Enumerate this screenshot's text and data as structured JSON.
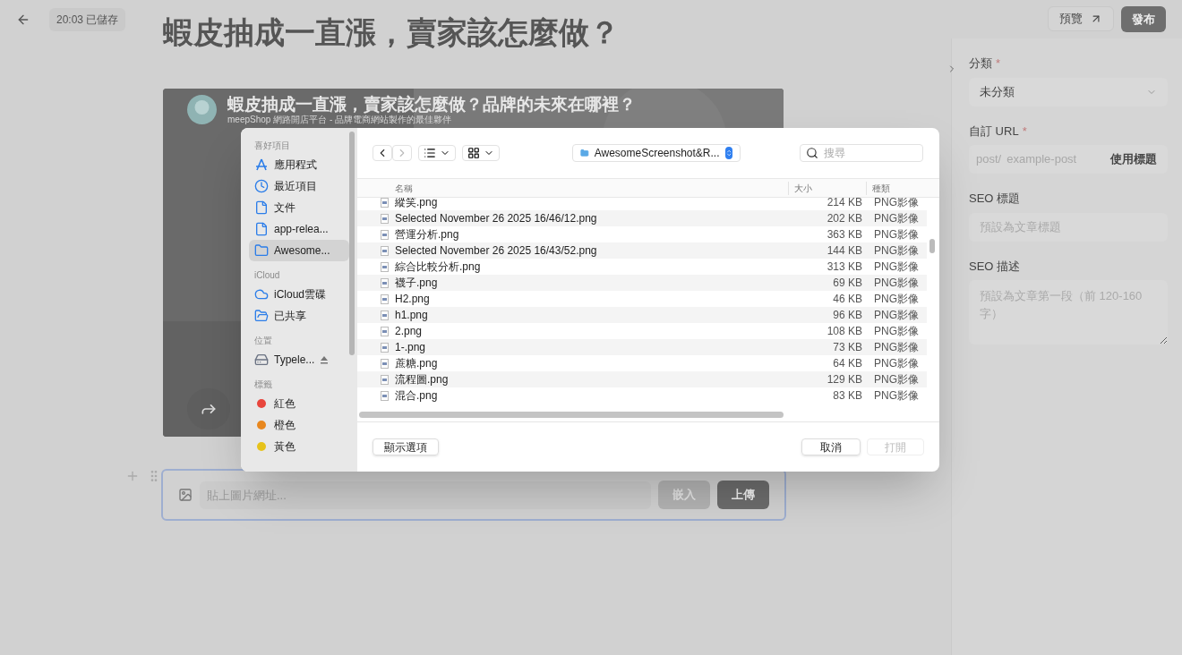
{
  "header": {
    "saved_status": "20:03 已儲存",
    "preview_button": "預覽",
    "publish_button": "發布"
  },
  "article": {
    "title": "蝦皮抽成一直漲，賣家該怎麼做？",
    "embed": {
      "kind": "picture",
      "title": "蝦皮抽成一直漲，賣家該怎麼做？品牌的未來在哪裡？",
      "channel": "meepShop 網路開店平台 - 品牌電商網站製作的最佳夥伴"
    },
    "image_block": {
      "placeholder": "貼上圖片網址...",
      "embed_button": "嵌入",
      "upload_button": "上傳"
    }
  },
  "settings": {
    "category": {
      "label": "分類",
      "required_mark": "*",
      "value": "未分類"
    },
    "url": {
      "label": "自訂 URL",
      "required_mark": "*",
      "prefix": "post/",
      "placeholder": "example-post",
      "button": "使用標題"
    },
    "seo_title": {
      "label": "SEO 標題",
      "placeholder": "預設為文章標題"
    },
    "seo_description": {
      "label": "SEO 描述",
      "placeholder": "預設為文章第一段（前 120-160 字）"
    }
  },
  "file_dialog": {
    "sidebar": [
      {
        "heading": "喜好項目",
        "items": [
          {
            "kind": "apps",
            "label": "應用程式",
            "selected": false
          },
          {
            "kind": "recent",
            "label": "最近項目",
            "selected": false
          },
          {
            "kind": "document",
            "label": "文件",
            "selected": false
          },
          {
            "kind": "document",
            "label": "app-relea...",
            "selected": false
          },
          {
            "kind": "folder",
            "label": "Awesome...",
            "selected": true
          }
        ]
      },
      {
        "heading": "iCloud",
        "items": [
          {
            "kind": "cloud",
            "label": "iCloud雲碟",
            "selected": false
          },
          {
            "kind": "shared",
            "label": "已共享",
            "selected": false
          }
        ]
      },
      {
        "heading": "位置",
        "items": [
          {
            "kind": "drive",
            "label": "Typele...",
            "selected": false
          }
        ]
      },
      {
        "heading": "標籤",
        "items": [
          {
            "kind": "tag",
            "label": "紅色",
            "color": "#e8453c",
            "selected": false
          },
          {
            "kind": "tag",
            "label": "橙色",
            "color": "#e8871e",
            "selected": false
          },
          {
            "kind": "tag",
            "label": "黃色",
            "color": "#e6c21a",
            "selected": false
          }
        ]
      }
    ],
    "location": "AwesomeScreenshot&R...",
    "search_placeholder": "搜尋",
    "columns": [
      "名稱",
      "大小",
      "種類"
    ],
    "files": [
      {
        "name": "縱笑.png",
        "size": "214 KB",
        "type": "PNG影像"
      },
      {
        "name": "Selected November 26 2025 16/46/12.png",
        "size": "202 KB",
        "type": "PNG影像"
      },
      {
        "name": "營運分析.png",
        "size": "363 KB",
        "type": "PNG影像"
      },
      {
        "name": "Selected November 26 2025 16/43/52.png",
        "size": "144 KB",
        "type": "PNG影像"
      },
      {
        "name": "綜合比較分析.png",
        "size": "313 KB",
        "type": "PNG影像"
      },
      {
        "name": "襪子.png",
        "size": "69 KB",
        "type": "PNG影像"
      },
      {
        "name": "H2.png",
        "size": "46 KB",
        "type": "PNG影像"
      },
      {
        "name": "h1.png",
        "size": "96 KB",
        "type": "PNG影像"
      },
      {
        "name": "2.png",
        "size": "108 KB",
        "type": "PNG影像"
      },
      {
        "name": "1-.png",
        "size": "73 KB",
        "type": "PNG影像"
      },
      {
        "name": "蔗糖.png",
        "size": "64 KB",
        "type": "PNG影像"
      },
      {
        "name": "流程圖.png",
        "size": "129 KB",
        "type": "PNG影像"
      },
      {
        "name": "混合.png",
        "size": "83 KB",
        "type": "PNG影像"
      }
    ],
    "show_options_button": "顯示選項",
    "cancel_button": "取消",
    "open_button": {
      "label": "打開",
      "disabled": true
    }
  }
}
